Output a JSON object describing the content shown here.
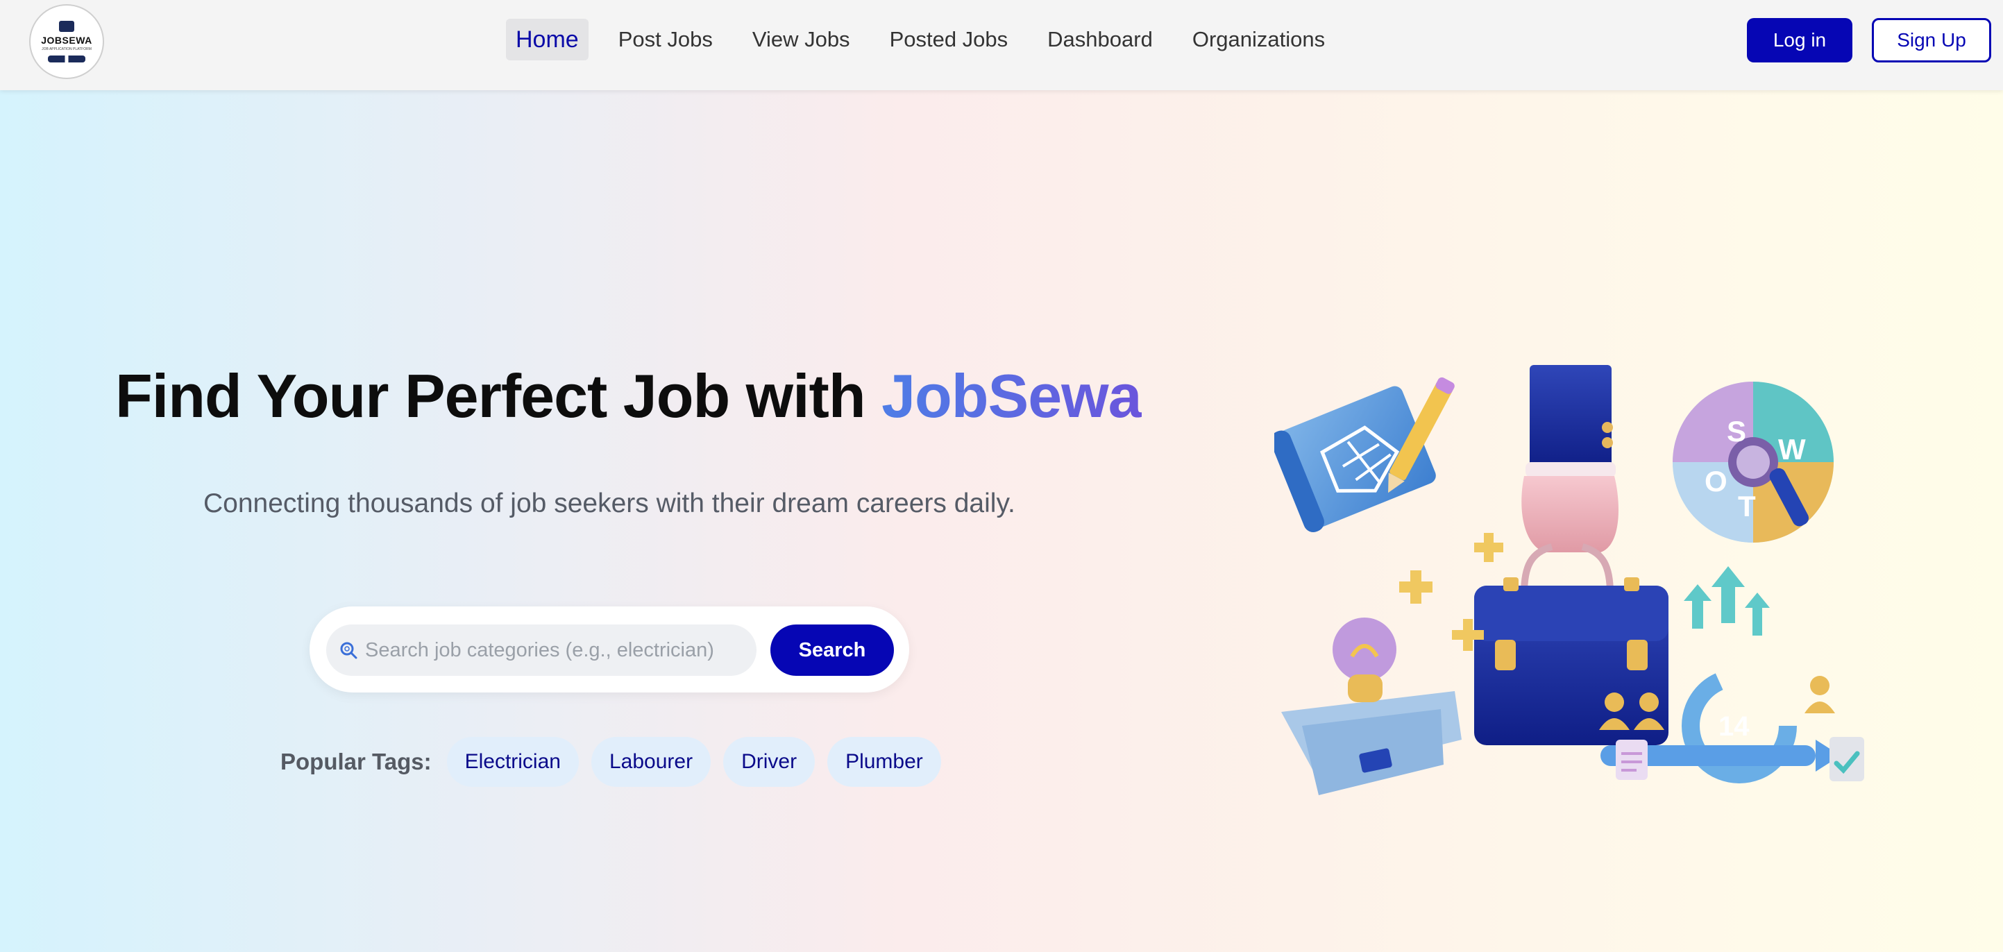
{
  "navbar": {
    "logo": {
      "name": "JOBSEWA",
      "tagline": "JOB APPLICATION PLATFORM"
    },
    "links": [
      {
        "label": "Home",
        "active": true
      },
      {
        "label": "Post Jobs",
        "active": false
      },
      {
        "label": "View Jobs",
        "active": false
      },
      {
        "label": "Posted Jobs",
        "active": false
      },
      {
        "label": "Dashboard",
        "active": false
      },
      {
        "label": "Organizations",
        "active": false
      }
    ],
    "login_label": "Log in",
    "signup_label": "Sign Up"
  },
  "hero": {
    "title_prefix": "Find Your Perfect Job with ",
    "title_brand": "JobSewa",
    "subtitle": "Connecting thousands of job seekers with their dream careers daily.",
    "search": {
      "placeholder": "Search job categories (e.g., electrician)",
      "value": "",
      "button_label": "Search",
      "icon": "search-icon"
    },
    "popular_tags": {
      "label": "Popular Tags:",
      "items": [
        "Electrician",
        "Labourer",
        "Driver",
        "Plumber"
      ]
    },
    "illustration": {
      "swot_letters": [
        "S",
        "W",
        "O",
        "T"
      ],
      "calendar_text": "14"
    }
  },
  "colors": {
    "primary": "#0606b4",
    "brand_gradient_start": "#4e7de6",
    "brand_gradient_end": "#6a55dc",
    "tag_bg": "#e1eefb"
  }
}
